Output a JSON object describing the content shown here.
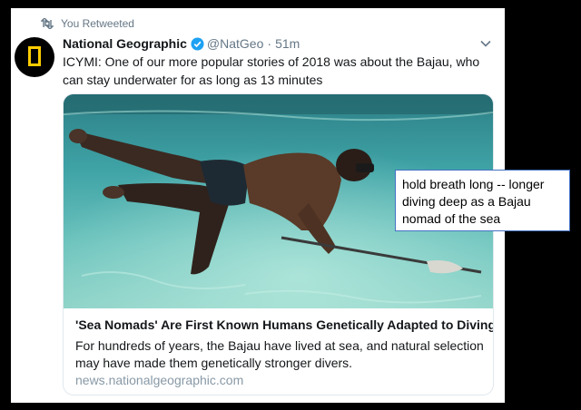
{
  "retweet": {
    "label": "You Retweeted",
    "icon": "retweet-icon"
  },
  "tweet": {
    "display_name": "National Geographic",
    "handle": "@NatGeo",
    "separator": "·",
    "time": "51m",
    "text": "ICYMI: One of our more popular stories of 2018 was about the Bajau, who can stay underwater for as long as 13 minutes",
    "verified_icon": "verified-badge-icon",
    "menu_icon": "chevron-down-icon"
  },
  "link_card": {
    "image": "underwater-spearfisher-photo",
    "title": "'Sea Nomads' Are First Known Humans Genetically Adapted to Diving",
    "description": "For hundreds of years, the Bajau have lived at sea, and natural selection may have made them genetically stronger divers.",
    "domain": "news.nationalgeographic.com"
  },
  "annotation": {
    "lines": [
      "hold breath long -- longer",
      "diving deep as a Bajau",
      "nomad of the sea"
    ]
  },
  "colors": {
    "background": "#000000",
    "verified": "#1da1f2",
    "secondary_text": "#657786",
    "logo_yellow": "#ffcc00",
    "note_border": "#4472c4"
  }
}
